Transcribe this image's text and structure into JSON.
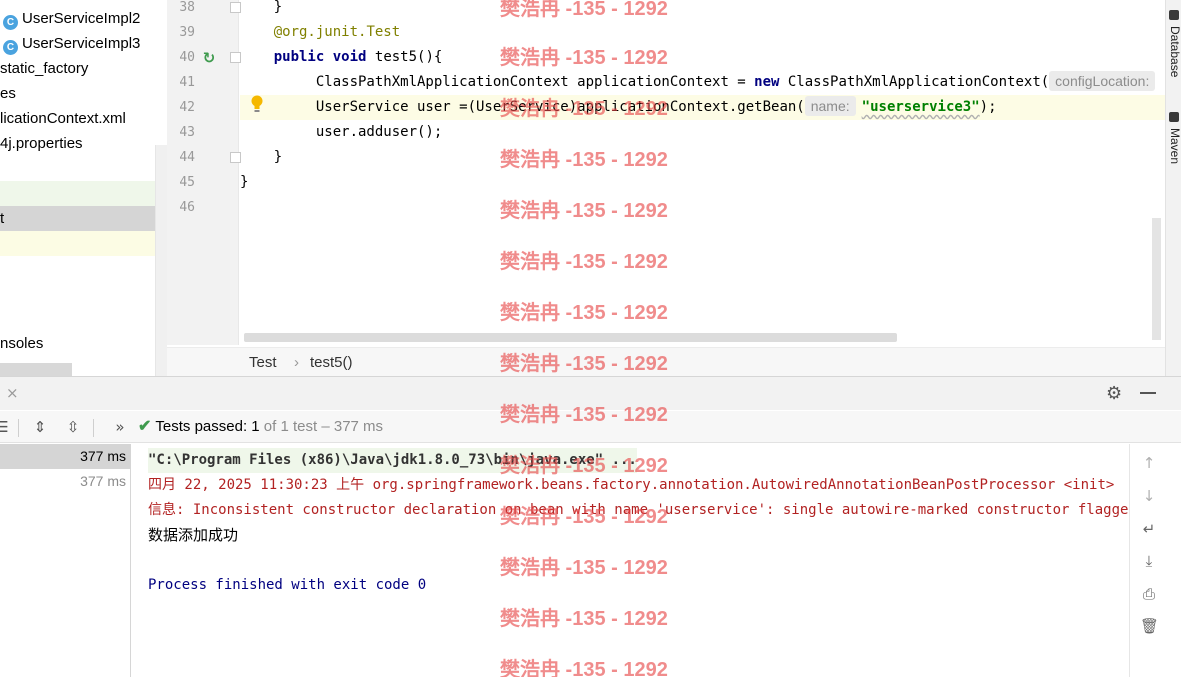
{
  "project_tree": {
    "items": [
      {
        "label": "UserServiceImpl2",
        "icon": "class-icon"
      },
      {
        "label": "UserServiceImpl3",
        "icon": "class-icon"
      },
      {
        "label": "static_factory"
      },
      {
        "label": "es"
      },
      {
        "label": "licationContext.xml"
      },
      {
        "label": "4j.properties"
      },
      {
        "label": "t"
      },
      {
        "label": "nsoles"
      }
    ],
    "class_icon_glyph": "C"
  },
  "editor": {
    "line_numbers": [
      "38",
      "39",
      "40",
      "41",
      "42",
      "43",
      "44",
      "45",
      "46"
    ],
    "code": {
      "l38": "}",
      "l39_ann": "@org.junit.",
      "l39_test": "Test",
      "l40_public": "public",
      "l40_void": "void",
      "l40_rest": "test5(){",
      "l41_a": "ClassPathXmlApplicationContext applicationContext = ",
      "l41_new": "new",
      "l41_b": " ClassPathXmlApplicationContext(",
      "l41_hint": "configLocation:",
      "l42_a": "UserService user =(UserService)applicationContext.getBean(",
      "l42_hint": "name:",
      "l42_str": "\"userservice3\"",
      "l42_b": ");",
      "l43": "user.adduser();",
      "l44": "}",
      "l45": "}"
    },
    "breadcrumbs": [
      "Test",
      "test5()"
    ],
    "breadcrumb_sep": "›"
  },
  "right_strip": {
    "tabs": [
      "Database",
      "Maven"
    ]
  },
  "run_window": {
    "close_glyph": "×",
    "status": {
      "prefix": "Tests passed: ",
      "count": "1",
      "suffix": " of 1 test – 377 ms"
    },
    "test_rows": [
      "377 ms",
      "377 ms"
    ],
    "console": {
      "cmd": "\"C:\\Program Files (x86)\\Java\\jdk1.8.0_73\\bin\\java.exe\" ...",
      "log1": "四月 22, 2025 11:30:23 上午 org.springframework.beans.factory.annotation.AutowiredAnnotationBeanPostProcessor <init>",
      "log2": "信息: Inconsistent constructor declaration on bean with name 'userservice': single autowire-marked constructor flagged as optional",
      "output": "数据添加成功",
      "exit": "Process finished with exit code 0"
    }
  },
  "watermark_text": "樊浩冉 -135 - 1292",
  "colors": {
    "keyword": "#000080",
    "annotation": "#808000",
    "string": "#008000",
    "pass_green": "#3f9b4e",
    "log_red": "#b22222",
    "watermark": "#e64646"
  }
}
